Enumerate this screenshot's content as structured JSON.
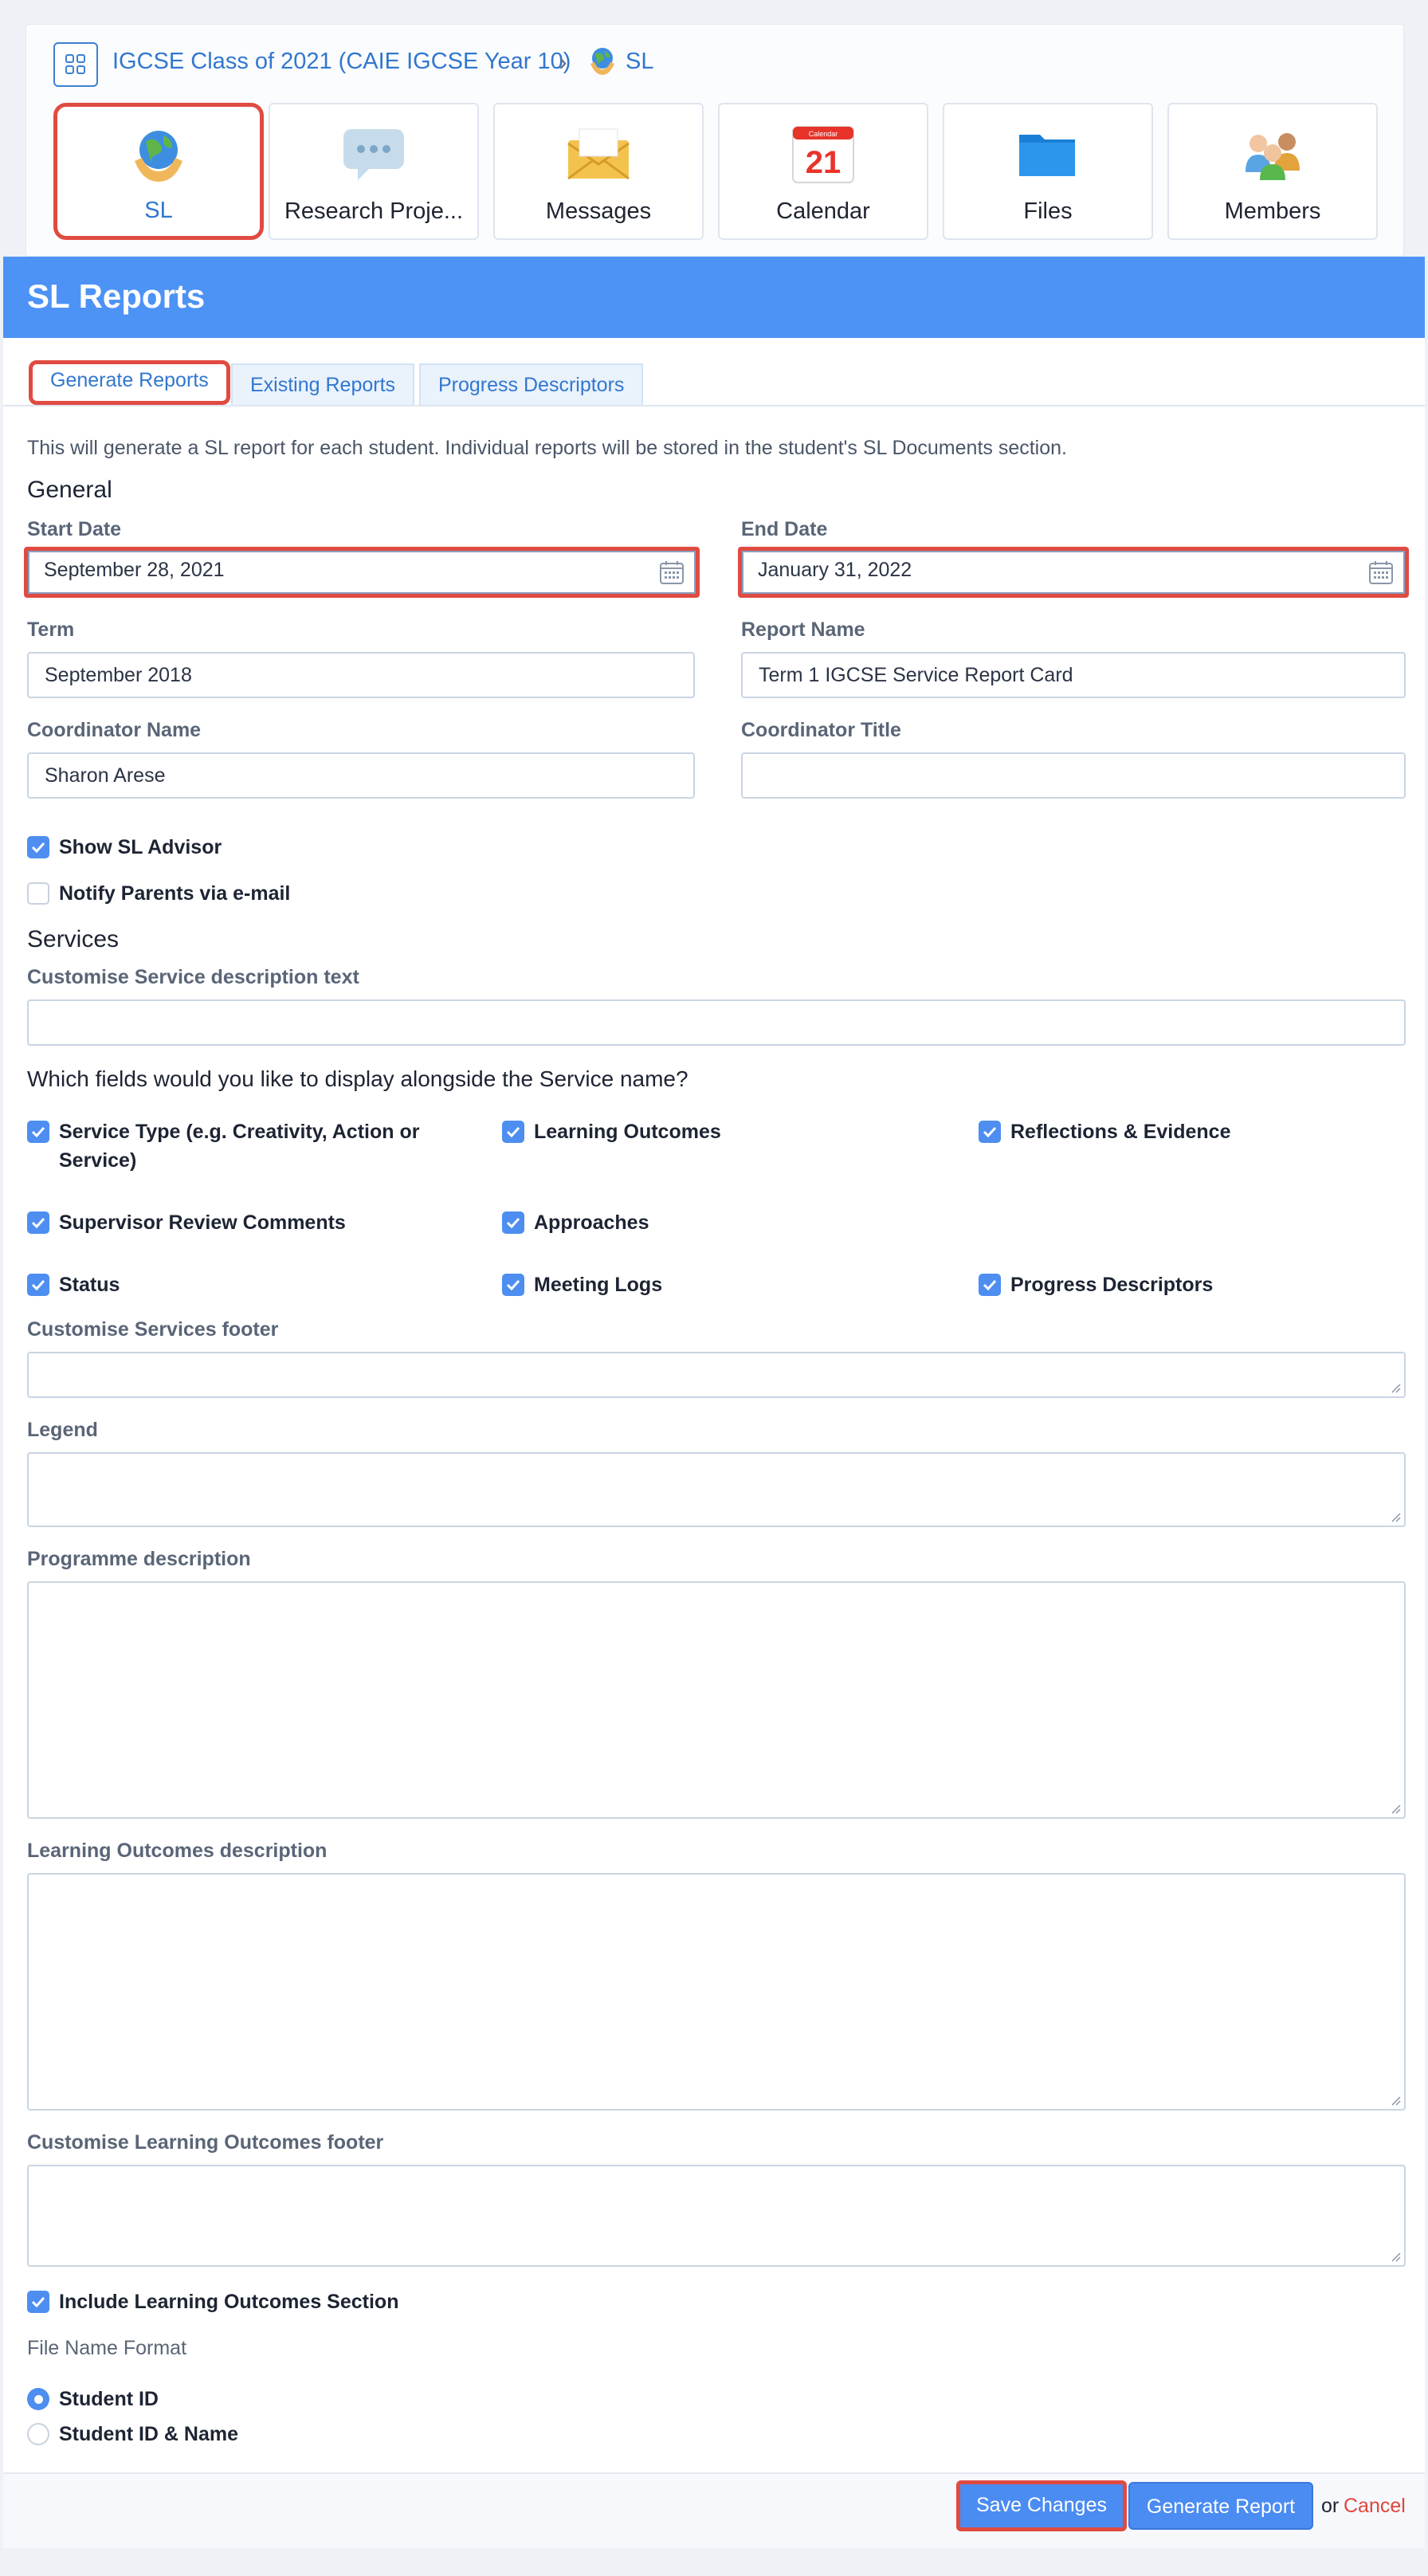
{
  "breadcrumb": {
    "parent": "IGCSE Class of 2021 (CAIE IGCSE Year 10)",
    "current": "SL"
  },
  "tools": [
    {
      "label": "SL",
      "icon": "globe-hands-icon"
    },
    {
      "label": "Research Proje...",
      "icon": "speech-bubble-icon"
    },
    {
      "label": "Messages",
      "icon": "envelope-icon"
    },
    {
      "label": "Calendar",
      "icon": "calendar-icon",
      "day": "21",
      "month": "Calendar"
    },
    {
      "label": "Files",
      "icon": "folder-icon"
    },
    {
      "label": "Members",
      "icon": "people-icon"
    }
  ],
  "panel": {
    "title": "SL Reports",
    "tabs": [
      "Generate Reports",
      "Existing Reports",
      "Progress Descriptors"
    ],
    "intro": "This will generate a SL report for each student. Individual reports will be stored in the student's SL Documents section."
  },
  "general": {
    "heading": "General",
    "start_date": {
      "label": "Start Date",
      "value": "September 28, 2021"
    },
    "end_date": {
      "label": "End Date",
      "value": "January 31, 2022"
    },
    "term": {
      "label": "Term",
      "value": "September 2018"
    },
    "report_name": {
      "label": "Report Name",
      "value": "Term 1 IGCSE Service Report Card"
    },
    "coordinator_name": {
      "label": "Coordinator Name",
      "value": "Sharon Arese"
    },
    "coordinator_title": {
      "label": "Coordinator Title",
      "value": ""
    },
    "show_advisor": "Show SL Advisor",
    "notify_parents": "Notify Parents via e-mail"
  },
  "services": {
    "heading": "Services",
    "description_label": "Customise Service description text",
    "fields_question": "Which fields would you like to display alongside the Service name?",
    "fields": [
      "Service Type (e.g. Creativity, Action or Service)",
      "Learning Outcomes",
      "Reflections & Evidence",
      "Supervisor Review Comments",
      "Approaches",
      "Status",
      "Meeting Logs",
      "Progress Descriptors"
    ],
    "footer_label": "Customise Services footer",
    "legend_label": "Legend",
    "programme_label": "Programme description",
    "lo_description_label": "Learning Outcomes description",
    "lo_footer_label": "Customise Learning Outcomes footer",
    "include_lo": "Include Learning Outcomes Section",
    "file_name_format": "File Name Format",
    "file_options": [
      "Student ID",
      "Student ID & Name"
    ]
  },
  "actions": {
    "save": "Save Changes",
    "generate": "Generate Report",
    "or": "or",
    "cancel": "Cancel"
  },
  "colors": {
    "accent": "#4d93f6",
    "link": "#3177cf",
    "highlight": "#e04b41"
  }
}
